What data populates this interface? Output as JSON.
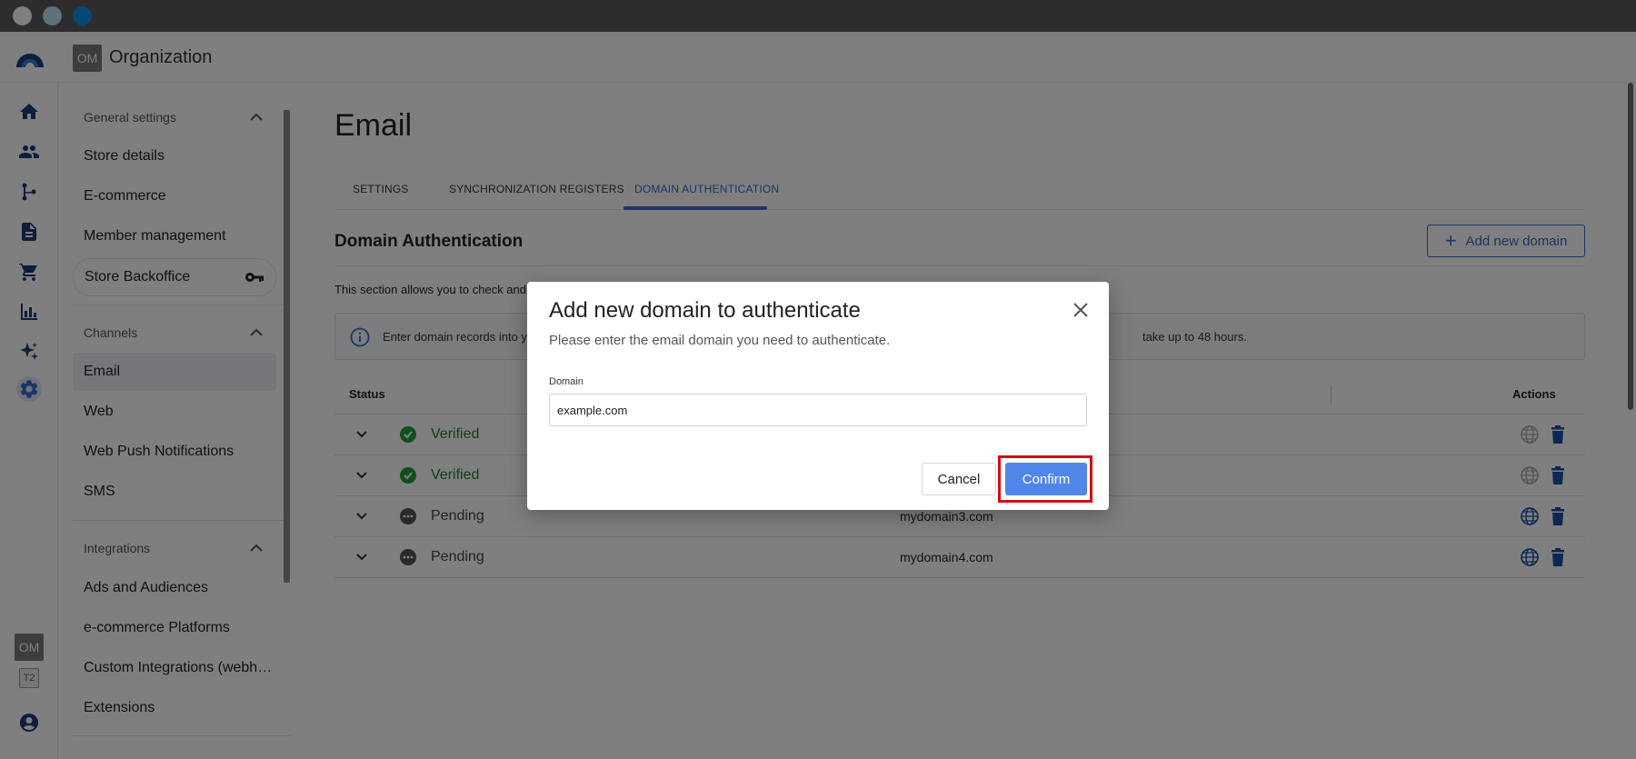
{
  "header": {
    "org_badge": "OM",
    "org_name": "Organization"
  },
  "rail": {
    "icons": [
      "home-icon",
      "people-icon",
      "flow-icon",
      "document-icon",
      "cart-icon",
      "chart-icon",
      "sparkle-icon",
      "gear-icon"
    ],
    "active": "gear-icon",
    "bottom_badge": "OM",
    "bottom_badge2": "T2"
  },
  "sidebar": {
    "general_settings": {
      "title": "General settings",
      "items": [
        "Store details",
        "E-commerce",
        "Member management",
        "Store Backoffice"
      ]
    },
    "channels": {
      "title": "Channels",
      "items": [
        "Email",
        "Web",
        "Web Push Notifications",
        "SMS"
      ]
    },
    "integrations": {
      "title": "Integrations",
      "items": [
        "Ads and Audiences",
        "e-commerce Platforms",
        "Custom Integrations (webh…",
        "Extensions"
      ]
    }
  },
  "main": {
    "title": "Email",
    "tabs": [
      "SETTINGS",
      "SYNCHRONIZATION REGISTERS",
      "DOMAIN AUTHENTICATION"
    ],
    "active_tab": "DOMAIN AUTHENTICATION",
    "section_title": "Domain Authentication",
    "add_button": "Add new domain",
    "intro": "This section allows you to check and",
    "info_text": "Enter domain records into y",
    "info_text_end": "take up to 48 hours.",
    "table": {
      "headers": {
        "status": "Status",
        "actions": "Actions"
      },
      "rows": [
        {
          "status": "Verified",
          "domain": ""
        },
        {
          "status": "Verified",
          "domain": ""
        },
        {
          "status": "Pending",
          "domain": "mydomain3.com"
        },
        {
          "status": "Pending",
          "domain": "mydomain4.com"
        }
      ]
    }
  },
  "modal": {
    "title": "Add new domain to authenticate",
    "subtitle": "Please enter the email domain you need to authenticate.",
    "field_label": "Domain",
    "field_value": "example.com",
    "cancel": "Cancel",
    "confirm": "Confirm"
  },
  "colors": {
    "accent": "#3a68c9",
    "confirm": "#4f86e8",
    "verified": "#1e7e2e",
    "highlight": "#d01010"
  }
}
